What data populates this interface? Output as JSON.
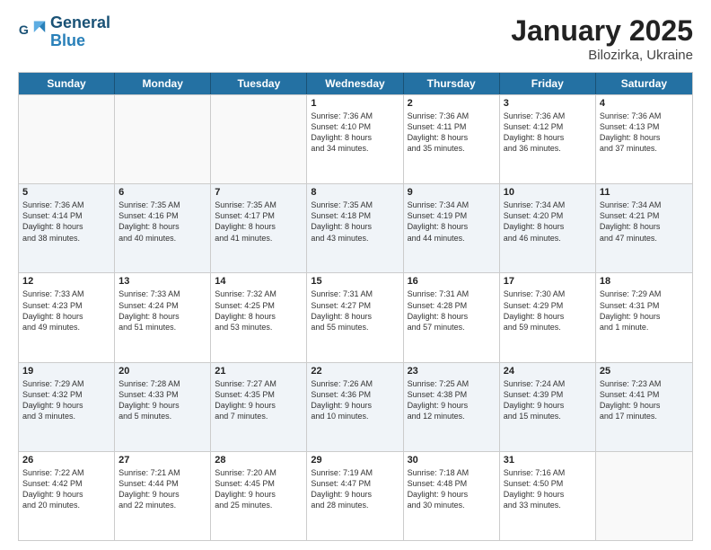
{
  "header": {
    "logo_line1": "General",
    "logo_line2": "Blue",
    "month_title": "January 2025",
    "subtitle": "Bilozirka, Ukraine"
  },
  "weekdays": [
    "Sunday",
    "Monday",
    "Tuesday",
    "Wednesday",
    "Thursday",
    "Friday",
    "Saturday"
  ],
  "rows": [
    [
      {
        "day": "",
        "info": ""
      },
      {
        "day": "",
        "info": ""
      },
      {
        "day": "",
        "info": ""
      },
      {
        "day": "1",
        "info": "Sunrise: 7:36 AM\nSunset: 4:10 PM\nDaylight: 8 hours\nand 34 minutes."
      },
      {
        "day": "2",
        "info": "Sunrise: 7:36 AM\nSunset: 4:11 PM\nDaylight: 8 hours\nand 35 minutes."
      },
      {
        "day": "3",
        "info": "Sunrise: 7:36 AM\nSunset: 4:12 PM\nDaylight: 8 hours\nand 36 minutes."
      },
      {
        "day": "4",
        "info": "Sunrise: 7:36 AM\nSunset: 4:13 PM\nDaylight: 8 hours\nand 37 minutes."
      }
    ],
    [
      {
        "day": "5",
        "info": "Sunrise: 7:36 AM\nSunset: 4:14 PM\nDaylight: 8 hours\nand 38 minutes."
      },
      {
        "day": "6",
        "info": "Sunrise: 7:35 AM\nSunset: 4:16 PM\nDaylight: 8 hours\nand 40 minutes."
      },
      {
        "day": "7",
        "info": "Sunrise: 7:35 AM\nSunset: 4:17 PM\nDaylight: 8 hours\nand 41 minutes."
      },
      {
        "day": "8",
        "info": "Sunrise: 7:35 AM\nSunset: 4:18 PM\nDaylight: 8 hours\nand 43 minutes."
      },
      {
        "day": "9",
        "info": "Sunrise: 7:34 AM\nSunset: 4:19 PM\nDaylight: 8 hours\nand 44 minutes."
      },
      {
        "day": "10",
        "info": "Sunrise: 7:34 AM\nSunset: 4:20 PM\nDaylight: 8 hours\nand 46 minutes."
      },
      {
        "day": "11",
        "info": "Sunrise: 7:34 AM\nSunset: 4:21 PM\nDaylight: 8 hours\nand 47 minutes."
      }
    ],
    [
      {
        "day": "12",
        "info": "Sunrise: 7:33 AM\nSunset: 4:23 PM\nDaylight: 8 hours\nand 49 minutes."
      },
      {
        "day": "13",
        "info": "Sunrise: 7:33 AM\nSunset: 4:24 PM\nDaylight: 8 hours\nand 51 minutes."
      },
      {
        "day": "14",
        "info": "Sunrise: 7:32 AM\nSunset: 4:25 PM\nDaylight: 8 hours\nand 53 minutes."
      },
      {
        "day": "15",
        "info": "Sunrise: 7:31 AM\nSunset: 4:27 PM\nDaylight: 8 hours\nand 55 minutes."
      },
      {
        "day": "16",
        "info": "Sunrise: 7:31 AM\nSunset: 4:28 PM\nDaylight: 8 hours\nand 57 minutes."
      },
      {
        "day": "17",
        "info": "Sunrise: 7:30 AM\nSunset: 4:29 PM\nDaylight: 8 hours\nand 59 minutes."
      },
      {
        "day": "18",
        "info": "Sunrise: 7:29 AM\nSunset: 4:31 PM\nDaylight: 9 hours\nand 1 minute."
      }
    ],
    [
      {
        "day": "19",
        "info": "Sunrise: 7:29 AM\nSunset: 4:32 PM\nDaylight: 9 hours\nand 3 minutes."
      },
      {
        "day": "20",
        "info": "Sunrise: 7:28 AM\nSunset: 4:33 PM\nDaylight: 9 hours\nand 5 minutes."
      },
      {
        "day": "21",
        "info": "Sunrise: 7:27 AM\nSunset: 4:35 PM\nDaylight: 9 hours\nand 7 minutes."
      },
      {
        "day": "22",
        "info": "Sunrise: 7:26 AM\nSunset: 4:36 PM\nDaylight: 9 hours\nand 10 minutes."
      },
      {
        "day": "23",
        "info": "Sunrise: 7:25 AM\nSunset: 4:38 PM\nDaylight: 9 hours\nand 12 minutes."
      },
      {
        "day": "24",
        "info": "Sunrise: 7:24 AM\nSunset: 4:39 PM\nDaylight: 9 hours\nand 15 minutes."
      },
      {
        "day": "25",
        "info": "Sunrise: 7:23 AM\nSunset: 4:41 PM\nDaylight: 9 hours\nand 17 minutes."
      }
    ],
    [
      {
        "day": "26",
        "info": "Sunrise: 7:22 AM\nSunset: 4:42 PM\nDaylight: 9 hours\nand 20 minutes."
      },
      {
        "day": "27",
        "info": "Sunrise: 7:21 AM\nSunset: 4:44 PM\nDaylight: 9 hours\nand 22 minutes."
      },
      {
        "day": "28",
        "info": "Sunrise: 7:20 AM\nSunset: 4:45 PM\nDaylight: 9 hours\nand 25 minutes."
      },
      {
        "day": "29",
        "info": "Sunrise: 7:19 AM\nSunset: 4:47 PM\nDaylight: 9 hours\nand 28 minutes."
      },
      {
        "day": "30",
        "info": "Sunrise: 7:18 AM\nSunset: 4:48 PM\nDaylight: 9 hours\nand 30 minutes."
      },
      {
        "day": "31",
        "info": "Sunrise: 7:16 AM\nSunset: 4:50 PM\nDaylight: 9 hours\nand 33 minutes."
      },
      {
        "day": "",
        "info": ""
      }
    ]
  ]
}
